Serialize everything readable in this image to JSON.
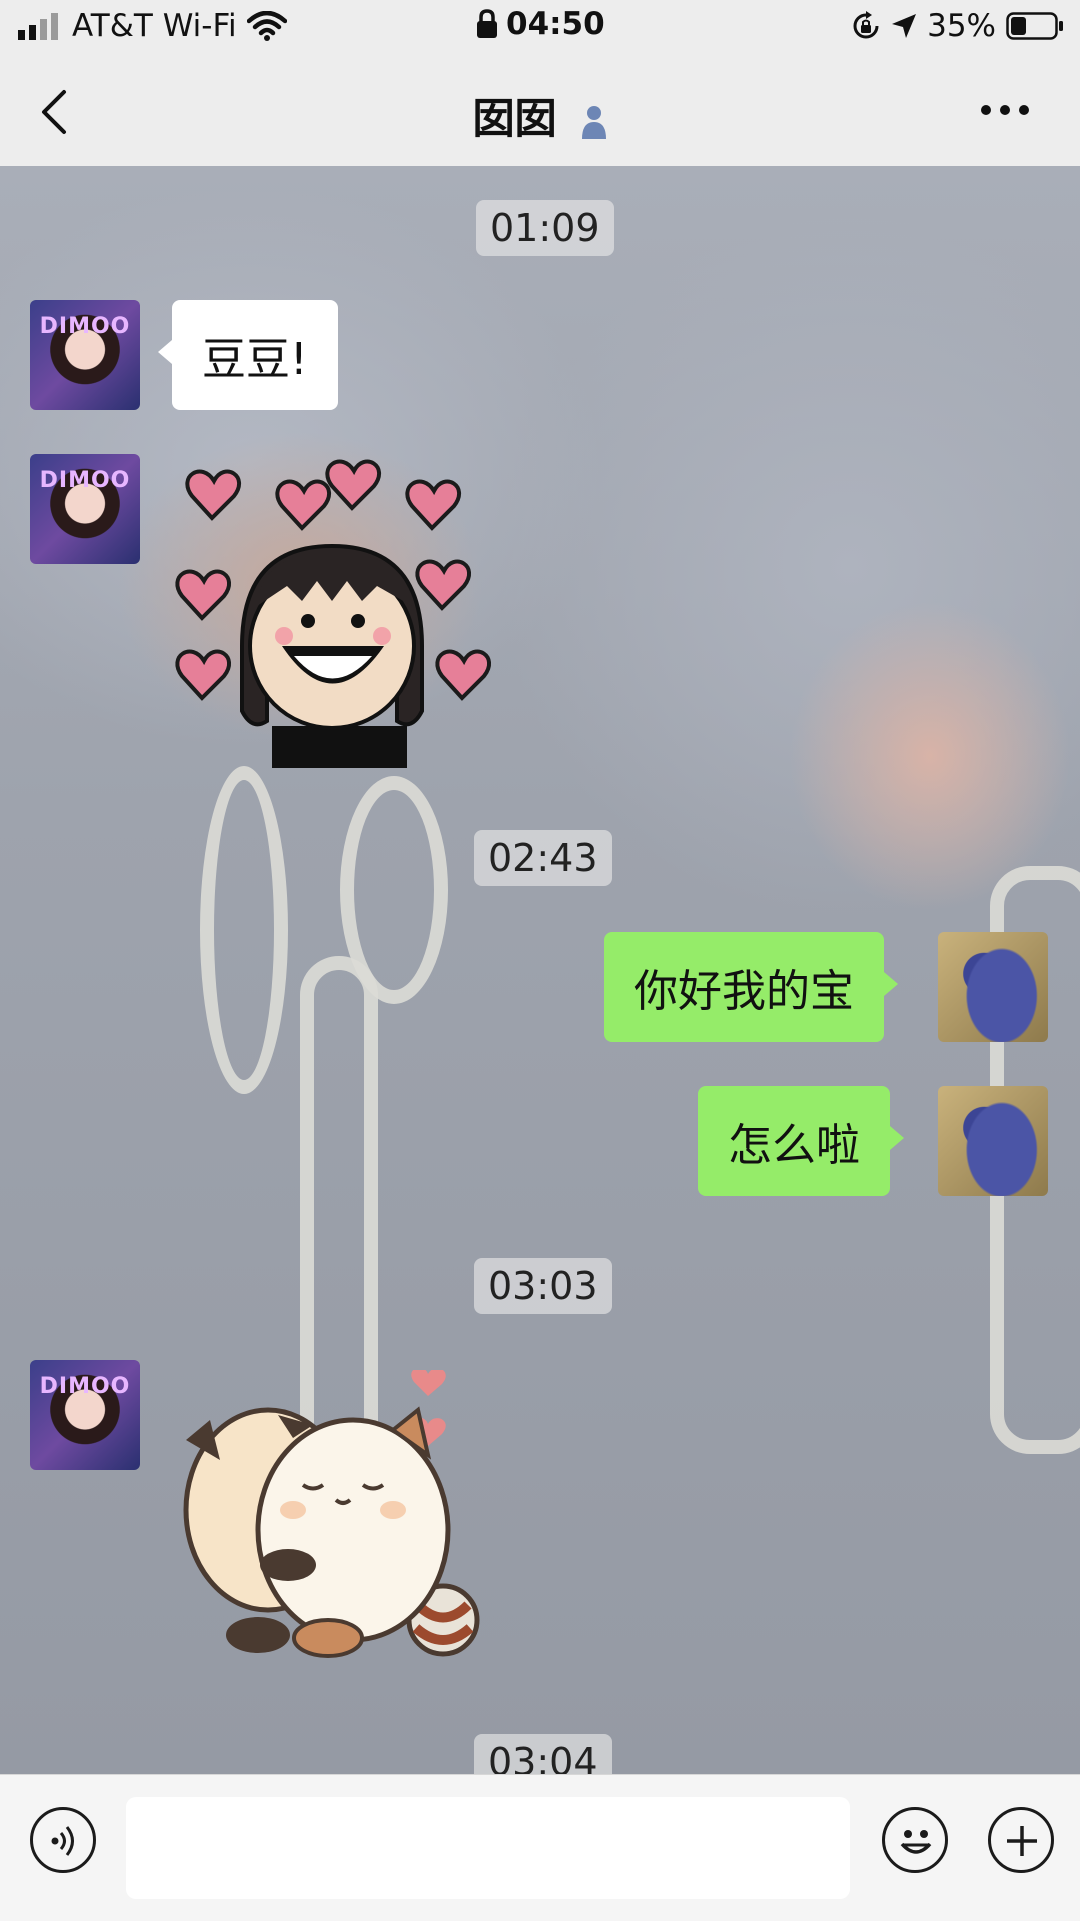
{
  "status_bar": {
    "carrier": "AT&T Wi-Fi",
    "time": "04:50",
    "battery": "35%"
  },
  "nav": {
    "title": "囡囡"
  },
  "messages": {
    "t1": "01:09",
    "m1": "豆豆!",
    "t2": "02:43",
    "m3": "你好我的宝",
    "m4": "怎么啦",
    "t3": "03:03",
    "t4": "03:04"
  },
  "avatars": {
    "contact_text": "DIMOO"
  },
  "colors": {
    "sent_bubble": "#95ec69",
    "received_bubble": "#ffffff",
    "bar_background": "#ededed"
  },
  "icons": {
    "signal": "signal-icon",
    "wifi": "wifi-icon",
    "lock": "lock-icon",
    "rotation_lock": "rotation-lock-icon",
    "location": "location-arrow-icon",
    "battery": "battery-icon",
    "back": "back-chevron-icon",
    "person": "person-icon",
    "more": "more-icon",
    "voice": "voice-icon",
    "emoji": "emoji-icon",
    "plus": "plus-icon"
  }
}
